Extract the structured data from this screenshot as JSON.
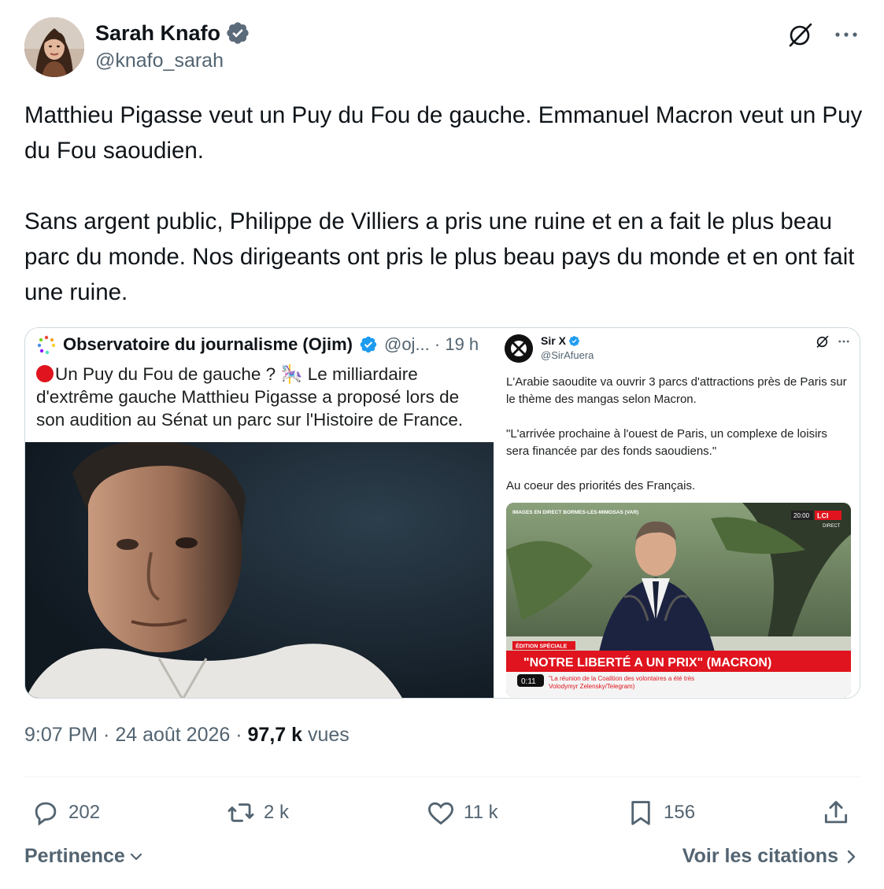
{
  "author": {
    "name": "Sarah Knafo",
    "handle": "@knafo_sarah"
  },
  "icons": {
    "verified": "verified-badge-icon",
    "grok": "grok-icon",
    "more": "more-icon",
    "reply": "reply-icon",
    "retweet": "retweet-icon",
    "like": "like-icon",
    "bookmark": "bookmark-icon",
    "share": "share-icon"
  },
  "tweet": {
    "paragraph1": "Matthieu Pigasse veut un Puy du Fou de gauche. Emmanuel Macron veut un Puy du Fou saoudien.",
    "paragraph2": "Sans argent public, Philippe de Villiers a pris une ruine et en a fait le plus beau parc du monde. Nos dirigeants ont pris le plus beau pays du monde et en ont fait une ruine."
  },
  "media": {
    "left": {
      "account_name": "Observatoire du journalisme (Ojim)",
      "handle_time": "@oj... · 19 h",
      "text": "Un Puy du Fou de gauche ? 🎠 Le milliardaire d'extrême gauche Matthieu Pigasse a proposé lors de son audition au Sénat un parc sur l'Histoire de France."
    },
    "right": {
      "account_name": "Sir X",
      "handle": "@SirAfuera",
      "line1": "L'Arabie saoudite va ouvrir 3 parcs d'attractions près de Paris sur le thème des mangas selon Macron.",
      "line2": "\"L'arrivée prochaine à l'ouest de Paris, un complexe de loisirs sera financée par des fonds saoudiens.\"",
      "line3": "Au coeur des priorités des Français.",
      "tv": {
        "top_left": "IMAGES EN DIRECT  BORMES-LES-MIMOSAS (VAR)",
        "clock": "20:00",
        "channel": "LCI",
        "live": "DIRECT",
        "edition": "ÉDITION SPÉCIALE",
        "headline": "\"NOTRE LIBERTÉ A UN PRIX\" (MACRON)",
        "ticker": "\"La réunion de la Coalition des volontaires a été très",
        "ticker2": "Volodymyr Zelensky/Telegram)",
        "timer": "0:11"
      }
    }
  },
  "meta": {
    "time": "9:07 PM",
    "sep": " · ",
    "date": "24 août 2026",
    "views_count": "97,7 k",
    "views_label": "vues"
  },
  "actions": {
    "replies": "202",
    "retweets": "2 k",
    "likes": "11 k",
    "bookmarks": "156"
  },
  "footer": {
    "sort_label": "Pertinence",
    "quotes_label": "Voir les citations"
  },
  "colors": {
    "text": "#0f1419",
    "secondary": "#536471",
    "verified": "#1d9bf0",
    "divider": "#eff3f4",
    "tv_red": "#e0141e"
  }
}
